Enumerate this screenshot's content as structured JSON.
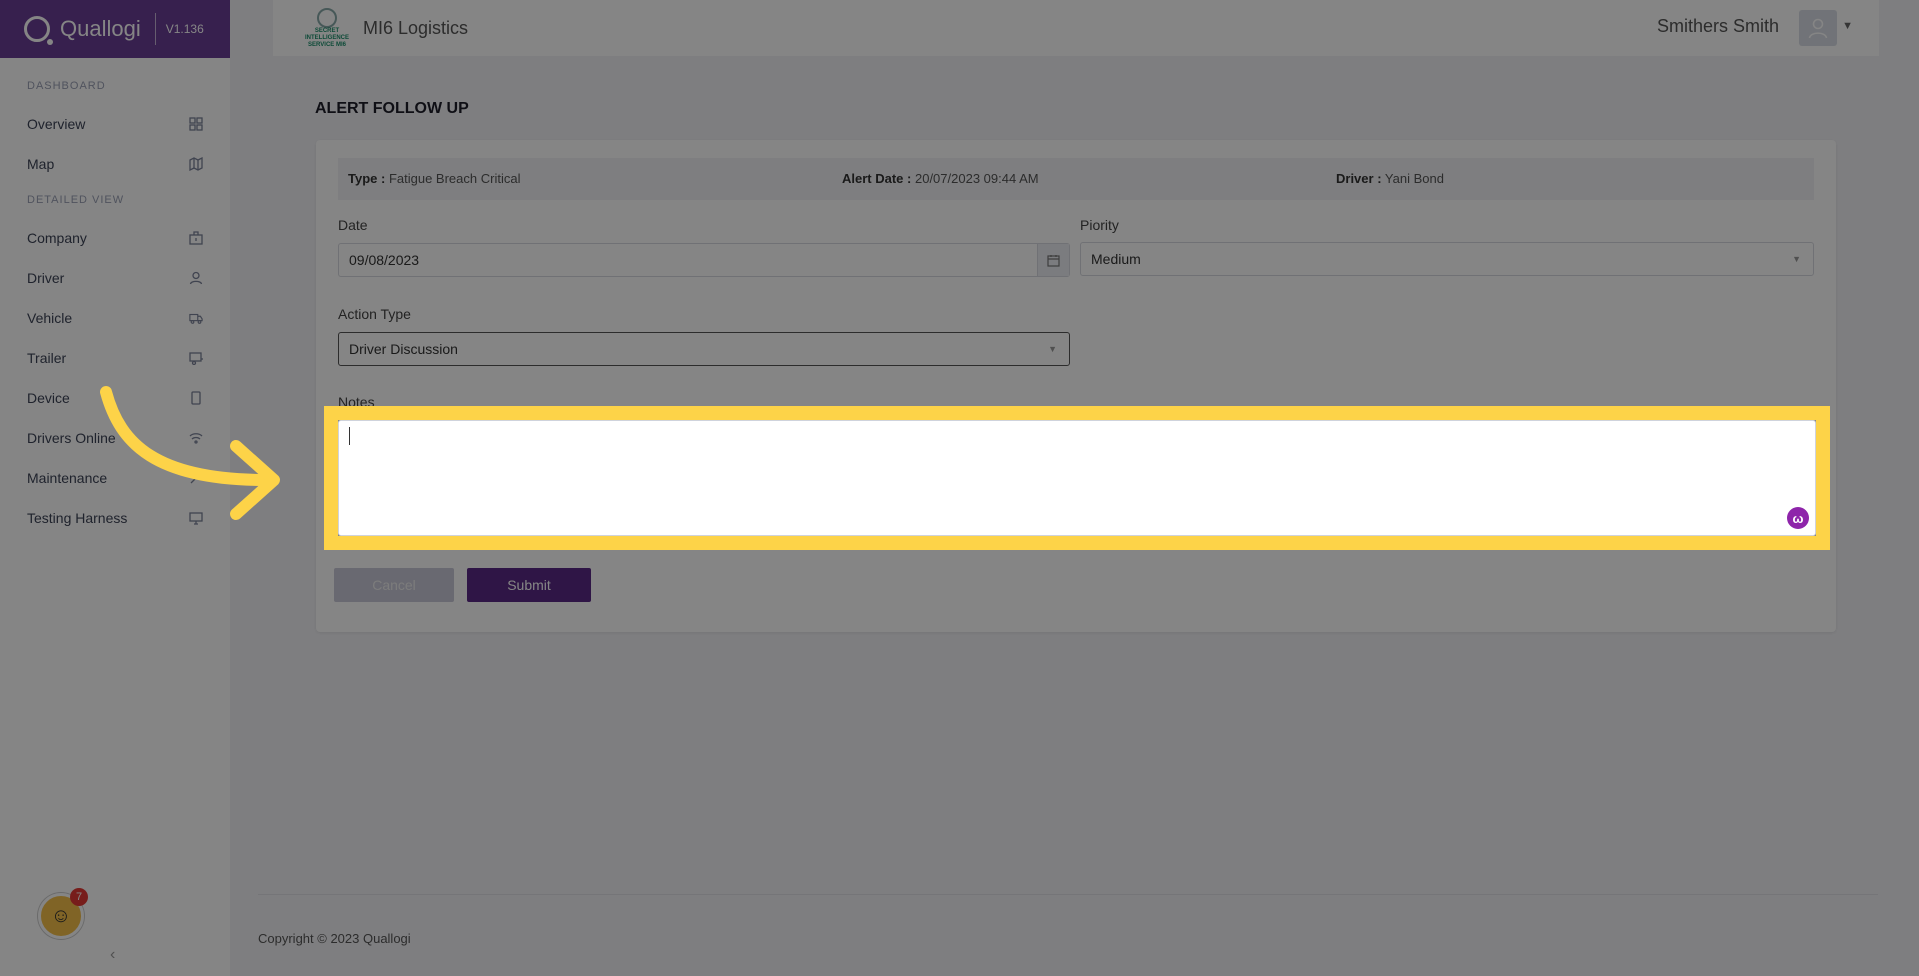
{
  "brand": {
    "name": "Quallogi",
    "version": "V1.136"
  },
  "sidebar": {
    "sections": [
      {
        "label": "DASHBOARD"
      },
      {
        "label": "DETAILED VIEW"
      }
    ],
    "dashboard_items": [
      {
        "label": "Overview",
        "icon": "grid-icon"
      },
      {
        "label": "Map",
        "icon": "map-icon"
      }
    ],
    "detail_items": [
      {
        "label": "Company",
        "icon": "building-icon"
      },
      {
        "label": "Driver",
        "icon": "user-icon"
      },
      {
        "label": "Vehicle",
        "icon": "truck-icon"
      },
      {
        "label": "Trailer",
        "icon": "trailer-icon"
      },
      {
        "label": "Device",
        "icon": "phone-icon"
      },
      {
        "label": "Drivers Online",
        "icon": "wifi-icon"
      },
      {
        "label": "Maintenance",
        "icon": "wrench-icon"
      },
      {
        "label": "Testing Harness",
        "icon": "monitor-icon"
      }
    ],
    "helper_badge": "7"
  },
  "header": {
    "org_name": "MI6 Logistics",
    "org_logo_text": "SECRET INTELLIGENCE SERVICE MI6",
    "user_name": "Smithers Smith"
  },
  "page": {
    "title": "ALERT FOLLOW UP",
    "info": {
      "type_label": "Type :",
      "type_value": "Fatigue Breach Critical",
      "alert_date_label": "Alert Date :",
      "alert_date_value": "20/07/2023 09:44 AM",
      "driver_label": "Driver :",
      "driver_value": "Yani Bond"
    },
    "form": {
      "date_label": "Date",
      "date_value": "09/08/2023",
      "priority_label": "Piority",
      "priority_value": "Medium",
      "action_type_label": "Action Type",
      "action_type_value": "Driver Discussion",
      "notes_label": "Notes",
      "notes_value": ""
    },
    "buttons": {
      "cancel": "Cancel",
      "submit": "Submit"
    }
  },
  "footer": {
    "copyright": "Copyright © 2023 Quallogi"
  },
  "colors": {
    "brand": "#6a3f96",
    "submit": "#5b2a86",
    "highlight": "#fdd348"
  }
}
